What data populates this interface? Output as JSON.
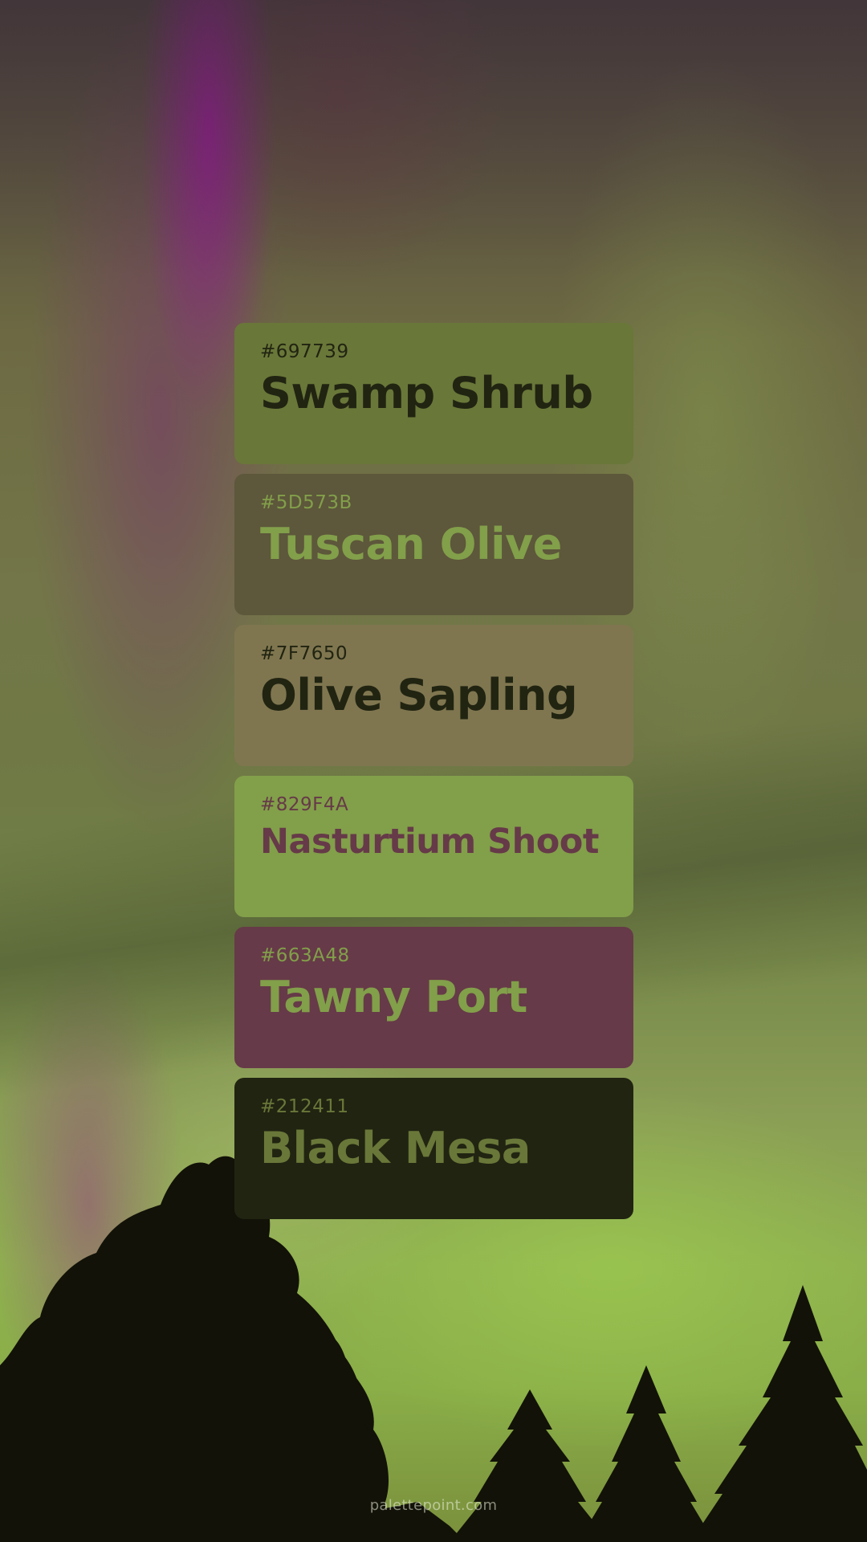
{
  "palette": [
    {
      "hex_label": "#697739",
      "name": "Swamp Shrub",
      "bg": "#697739",
      "fg": "#212411"
    },
    {
      "hex_label": "#5D573B",
      "name": "Tuscan Olive",
      "bg": "#5D573B",
      "fg": "#829F4A"
    },
    {
      "hex_label": "#7F7650",
      "name": "Olive Sapling",
      "bg": "#7F7650",
      "fg": "#212411"
    },
    {
      "hex_label": "#829F4A",
      "name": "Nasturtium Shoot",
      "bg": "#829F4A",
      "fg": "#663A48"
    },
    {
      "hex_label": "#663A48",
      "name": "Tawny Port",
      "bg": "#663A48",
      "fg": "#829F4A"
    },
    {
      "hex_label": "#212411",
      "name": "Black Mesa",
      "bg": "#212411",
      "fg": "#697739"
    }
  ],
  "footer": {
    "site": "palettepoint.com"
  },
  "background": {
    "description_icon": "aurora-forest-photo",
    "accent_colors": [
      "#8a1e8a",
      "#8fb04f",
      "#3a3a2c"
    ]
  }
}
